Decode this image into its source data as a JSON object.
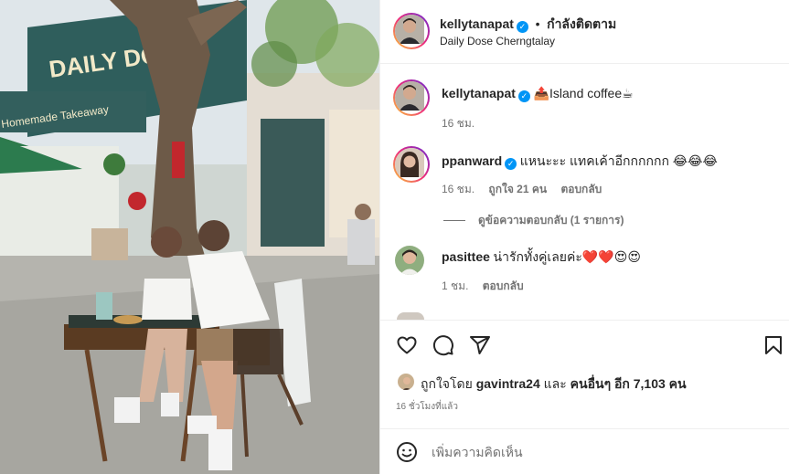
{
  "post": {
    "author": "kellytanapat",
    "separator": "•",
    "follow_status": "กำลังติดตาม",
    "location": "Daily Dose Cherngtalay"
  },
  "caption": {
    "author": "kellytanapat",
    "text": "📤Island coffee☕",
    "time": "16 ชม."
  },
  "comments": [
    {
      "author": "ppanward",
      "text": "แหนะะะ แทคเค้าอีกกกกกก 😂😂😂",
      "time": "16 ชม.",
      "likes": "ถูกใจ 21 คน",
      "reply": "ตอบกลับ",
      "view_replies": "ดูข้อความตอบกลับ (1 รายการ)"
    },
    {
      "author": "pasittee",
      "text": "น่ารักทั้งคู่เลยค่ะ❤️❤️😍😍",
      "time": "1 ชม.",
      "reply": "ตอบกลับ"
    }
  ],
  "likes": {
    "prefix": "ถูกใจโดย",
    "user": "gavintra24",
    "middle": "และ",
    "others": "คนอื่นๆ อีก 7,103 คน"
  },
  "timestamp": "16 ชั่วโมงที่แล้ว",
  "add_comment": {
    "placeholder": "เพิ่มความคิดเห็น"
  },
  "icons": {
    "like": "heart-icon",
    "comment": "comment-icon",
    "share": "share-icon",
    "save": "bookmark-icon",
    "emoji": "emoji-icon",
    "verified": "verified-badge-icon"
  },
  "photo_sign": {
    "line1": "DAILY DOSE",
    "line2": "Homemade Takeaway"
  },
  "colors": {
    "verified": "#0095f6",
    "text": "#262626",
    "muted": "#737373",
    "border": "#efefef"
  }
}
